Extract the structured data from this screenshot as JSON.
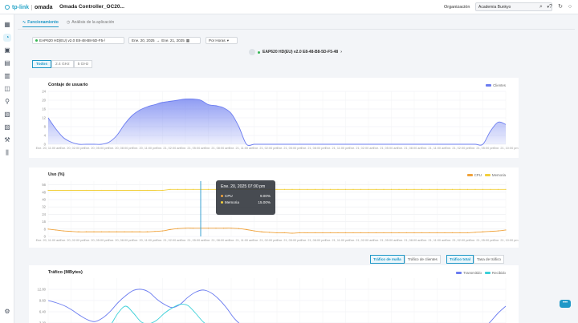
{
  "header": {
    "logo_tp": "tp-link",
    "logo_omada": "omada",
    "title": "Omada Controller_OC20...",
    "org_label": "Organización",
    "org_value": "Academia Bunkyo",
    "icons": [
      "search-icon",
      "help-icon",
      "refresh-icon",
      "user-icon"
    ]
  },
  "sidebar": {
    "icons": [
      "grid-icon",
      "monitor-icon",
      "devices-icon",
      "clients-icon",
      "logs-icon",
      "map-icon",
      "location-icon",
      "calendar-icon",
      "report-icon",
      "tools-icon",
      "stats-icon",
      "settings-icon"
    ]
  },
  "tabs": [
    {
      "label": "Funcionamiento",
      "icon": "activity-icon"
    },
    {
      "label": "Análisis de la aplicación",
      "icon": "clock-icon"
    }
  ],
  "filters": {
    "device": "EAP620 HD(EU) v2.0 E8-48-B8-5D-F5-/",
    "start_date": "Ene. 20, 2025",
    "end_date": "Ene. 21, 2025",
    "interval": "Por Horas"
  },
  "device_title": "EAP620 HD(EU) v2.0 E8-48-B8-5D-F5-48",
  "bands": [
    "Todos",
    "2.4 GHz",
    "5 GHz"
  ],
  "colors": {
    "accent": "#1f98c7",
    "clients": "#6b7cf0",
    "cpu": "#f0a23b",
    "memory": "#f2cf3c",
    "transmitted": "#6b7cf0",
    "received": "#3cd0d8"
  },
  "x_ticks": [
    "Ene. 20, 11:00 am",
    "Ene. 20, 02:00 pm",
    "Ene. 20, 05:00 pm",
    "Ene. 20, 08:00 pm",
    "Ene. 20, 11:00 pm",
    "Ene. 21, 02:00 am",
    "Ene. 21, 05:00 am",
    "Ene. 21, 08:00 am",
    "Ene. 21, 11:00 am",
    "Ene. 21, 02:00 pm",
    "Ene. 21, 05:00 pm",
    "Ene. 21, 08:00 pm",
    "Ene. 21, 11:00 pm",
    "Ene. 21, 02:00 am",
    "Ene. 21, 05:00 am",
    "Ene. 21, 08:00 am",
    "Ene. 21, 11:00 am",
    "Ene. 21, 02:00 pm",
    "Ene. 21, 05:00 pm",
    "Ene. 21, 10:00 pm"
  ],
  "segments": {
    "traffic_tabs": [
      "Tráfico de malla",
      "Tráfico de clientes"
    ],
    "rate_tabs": [
      "Tráfico total",
      "Tasa de tráfico"
    ]
  },
  "tooltip": {
    "title": "Ene. 20, 2025 07:00 pm",
    "rows": [
      {
        "label": "CPU",
        "value": "9.00%"
      },
      {
        "label": "Memoria",
        "value": "15.00%"
      }
    ]
  },
  "chart_data": [
    {
      "type": "area",
      "title": "Contaje de usuario",
      "ylim": [
        0,
        24
      ],
      "yticks": [
        0,
        4,
        8,
        12,
        16,
        20,
        24
      ],
      "series": [
        {
          "name": "Clientes",
          "values": [
            12,
            7,
            3,
            1,
            0,
            0,
            0,
            0,
            1,
            4,
            9,
            13,
            15.5,
            17,
            18,
            19,
            19.5,
            20,
            20.5,
            20.5,
            20,
            18,
            17.5,
            16.5,
            14,
            8,
            0,
            0,
            0,
            0,
            0,
            0,
            0,
            0,
            0,
            0,
            0,
            0,
            0,
            0,
            0,
            0,
            0,
            0,
            0,
            0,
            0,
            0,
            0,
            0,
            0,
            0,
            0,
            0,
            0,
            0,
            0,
            0,
            6,
            10,
            9
          ]
        }
      ]
    },
    {
      "type": "line",
      "title": "Uso (%)",
      "ylim": [
        0,
        60
      ],
      "yticks": [
        0,
        8,
        16,
        24,
        32,
        40,
        48,
        56
      ],
      "series": [
        {
          "name": "CPU",
          "values": [
            8,
            7,
            6,
            5.5,
            5,
            5,
            5,
            5,
            5,
            5,
            5,
            5,
            5,
            5,
            5.5,
            6,
            7.5,
            8.5,
            9,
            9,
            9,
            9,
            9,
            9,
            9,
            8.5,
            7.5,
            6,
            5,
            4.5,
            4,
            4,
            3.5,
            4,
            4,
            4,
            4,
            4,
            4,
            4,
            4,
            4,
            4,
            4,
            4,
            4,
            4,
            4,
            4,
            4,
            4,
            4,
            4,
            4,
            4,
            4,
            4.5,
            5,
            5.5,
            6,
            7
          ]
        },
        {
          "name": "Memoria",
          "values": [
            50,
            50,
            50,
            50,
            50,
            50,
            50,
            50,
            50,
            50,
            50,
            50,
            50,
            50,
            50,
            50,
            51,
            51,
            51,
            51,
            51,
            51,
            51,
            51,
            51,
            51,
            51,
            51,
            51,
            51,
            51,
            51,
            51,
            51,
            51,
            51,
            51,
            51,
            51,
            51,
            51,
            51,
            51,
            51,
            51,
            51,
            51,
            51,
            51,
            51,
            51,
            51,
            51,
            51,
            51,
            51,
            51,
            51,
            51,
            51,
            51
          ]
        }
      ]
    },
    {
      "type": "line",
      "title": "Tráfico (MBytes)",
      "ylim": [
        0,
        16
      ],
      "yticks": [
        0,
        3.2,
        6.4,
        9.6,
        12.8
      ],
      "ytick_labels": [
        "",
        "3.20",
        "6.40",
        "9.60",
        "12.80"
      ],
      "series": [
        {
          "name": "Transmitido",
          "values": [
            9.6,
            9,
            8.2,
            7,
            5.5,
            4.2,
            3.6,
            4.6,
            6.5,
            9,
            11,
            12.5,
            12.8,
            12,
            10,
            8.5,
            7.6,
            8.5,
            10.5,
            12,
            12.6,
            11.8,
            10,
            7.5,
            4.5,
            2.5,
            1.5,
            1,
            0.8,
            0.6,
            0.5,
            0.5,
            0.5,
            0.5,
            0.5,
            0.5,
            0.5,
            0.5,
            0.5,
            0.5,
            0.5,
            0.5,
            0.5,
            0.5,
            0.5,
            0.5,
            0.5,
            0.5,
            0.5,
            0.5,
            0.5,
            0.5,
            0.5,
            0.5,
            0.5,
            0.5,
            1.5,
            3.5,
            6,
            8
          ]
        },
        {
          "name": "Recibido",
          "values": [
            1,
            1,
            0.9,
            0.8,
            0.6,
            0.5,
            0.5,
            0.8,
            2.5,
            6,
            8,
            6,
            3.5,
            3,
            4,
            6,
            7.5,
            8.5,
            8.2,
            6,
            3.5,
            2,
            1.2,
            0.8,
            0.5,
            0.4,
            0.3,
            0.3,
            0.3,
            0.3,
            0.3,
            0.3,
            0.3,
            0.3,
            0.3,
            0.3,
            0.3,
            0.3,
            0.3,
            0.3,
            0.3,
            0.3,
            0.3,
            0.3,
            0.3,
            0.3,
            0.3,
            0.3,
            0.3,
            0.3,
            0.3,
            0.3,
            0.3,
            0.3,
            0.3,
            0.3,
            0.5,
            0.8,
            1,
            1.2
          ]
        }
      ]
    }
  ]
}
